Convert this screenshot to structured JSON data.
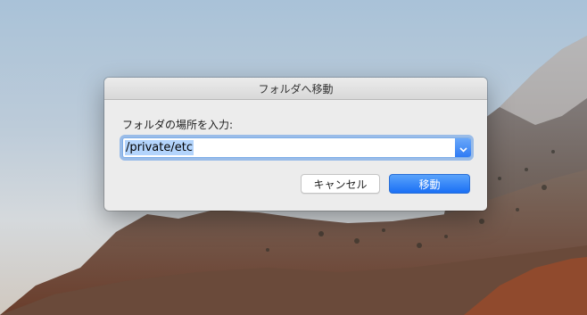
{
  "dialog": {
    "title": "フォルダへ移動",
    "prompt": "フォルダの場所を入力:",
    "path_value": "/private/etc",
    "cancel_label": "キャンセル",
    "go_label": "移動"
  },
  "colors": {
    "accent": "#2f7bf5",
    "dialog_bg": "#ececec",
    "selection": "#b3d4fc"
  },
  "icons": {
    "combo_arrow": "chevron-down-icon"
  }
}
